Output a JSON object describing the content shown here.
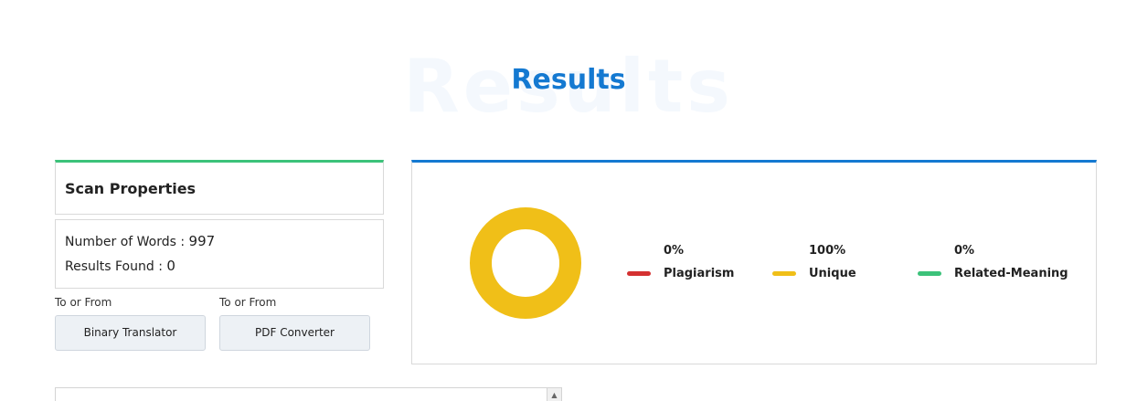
{
  "heading": {
    "ghost_text": "Results",
    "title": "Results"
  },
  "scan_properties": {
    "title": "Scan Properties",
    "words_label": "Number of Words :",
    "words_value": "997",
    "results_label": "Results Found :",
    "results_value": "0"
  },
  "tools": [
    {
      "caption": "To or From",
      "button": "Binary Translator"
    },
    {
      "caption": "To or From",
      "button": "PDF Converter"
    }
  ],
  "result_chart": {
    "type": "pie",
    "donut": true,
    "categories": [
      "Plagiarism",
      "Unique",
      "Related-Meaning"
    ],
    "values": [
      0,
      100,
      0
    ],
    "percent_labels": [
      "0%",
      "100%",
      "0%"
    ],
    "colors": [
      "#d43131",
      "#f0bf18",
      "#3cc27a"
    ]
  },
  "colors": {
    "accent_blue": "#1479d1",
    "accent_green": "#3cc27a"
  },
  "icons": {
    "scroll_up": "arrow-up-icon"
  }
}
